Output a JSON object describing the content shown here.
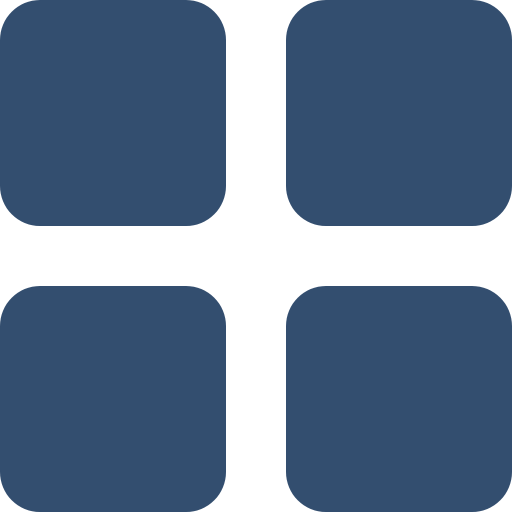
{
  "icon": {
    "name": "grid-view-icon",
    "color": "#334e6f",
    "background": "#ffffff",
    "tiles": [
      {
        "name": "grid-tile-top-left"
      },
      {
        "name": "grid-tile-top-right"
      },
      {
        "name": "grid-tile-bottom-left"
      },
      {
        "name": "grid-tile-bottom-right"
      }
    ]
  }
}
